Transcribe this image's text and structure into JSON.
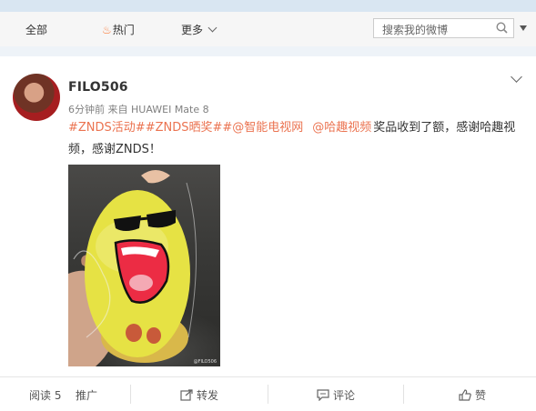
{
  "nav": {
    "all": "全部",
    "hot": "热门",
    "more": "更多"
  },
  "search": {
    "placeholder": "搜索我的微博"
  },
  "post": {
    "username": "FILO506",
    "time": "6分钟前",
    "via": "来自",
    "device": "HUAWEI Mate 8",
    "tags": [
      "#ZNDS活动#",
      "#ZNDS晒奖#",
      "#@智能电视网"
    ],
    "mention": "@哈趣视频",
    "text_line1_tail": "奖品收到了额，感谢哈趣视",
    "text_line2": "频，感谢ZNDS！",
    "photo_watermark": "@FILO506"
  },
  "actions": {
    "read": "阅读 5",
    "promote": "推广",
    "repost": "转发",
    "comment": "评论",
    "like": "赞"
  },
  "colors": {
    "accent": "#eb7350",
    "text": "#333333",
    "muted": "#808080",
    "page_bg": "#eef3f8"
  },
  "icons": {
    "hot": "flame-icon",
    "more": "chevron-down-icon",
    "search": "search-icon",
    "repost": "repost-icon",
    "comment": "comment-icon",
    "like": "thumbs-up-icon"
  }
}
